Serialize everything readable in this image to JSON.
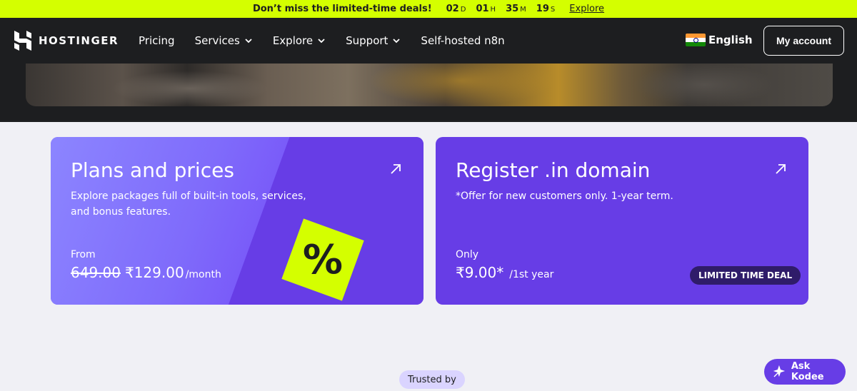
{
  "promo": {
    "message": "Don’t miss the limited-time deals!",
    "countdown": [
      {
        "value": "02",
        "unit": "D"
      },
      {
        "value": "01",
        "unit": "H"
      },
      {
        "value": "35",
        "unit": "M"
      },
      {
        "value": "19",
        "unit": "S"
      }
    ],
    "explore_label": "Explore",
    "bg_color": "#d4ff00"
  },
  "header": {
    "brand": "HOSTINGER",
    "nav": [
      {
        "label": "Pricing",
        "has_dropdown": false
      },
      {
        "label": "Services",
        "has_dropdown": true
      },
      {
        "label": "Explore",
        "has_dropdown": true
      },
      {
        "label": "Support",
        "has_dropdown": true
      },
      {
        "label": "Self-hosted n8n",
        "has_dropdown": false
      }
    ],
    "language": "English",
    "language_flag_icon": "india-flag-icon",
    "account_label": "My account",
    "bg_color": "#1d1e20"
  },
  "cards": [
    {
      "title": "Plans and prices",
      "description": "Explore packages full of built-in tools, services, and bonus features.",
      "price_label": "From",
      "old_price": "649.00",
      "new_price": "₹129.00",
      "period": "/month",
      "badge_symbol": "%",
      "arrow_icon": "external-arrow-icon"
    },
    {
      "title": "Register .in domain",
      "description": "*Offer for new customers only. 1-year term.",
      "price_label": "Only",
      "new_price": "₹9.00*",
      "period": "/1st year",
      "tag": "LIMITED TIME DEAL",
      "arrow_icon": "external-arrow-icon"
    }
  ],
  "trusted_label": "Trusted by",
  "assistant": {
    "label": "Ask Kodee",
    "icon": "sparkle-icon"
  },
  "colors": {
    "accent_purple": "#673de6",
    "lime": "#d4ff00",
    "dark": "#1d1e20"
  }
}
